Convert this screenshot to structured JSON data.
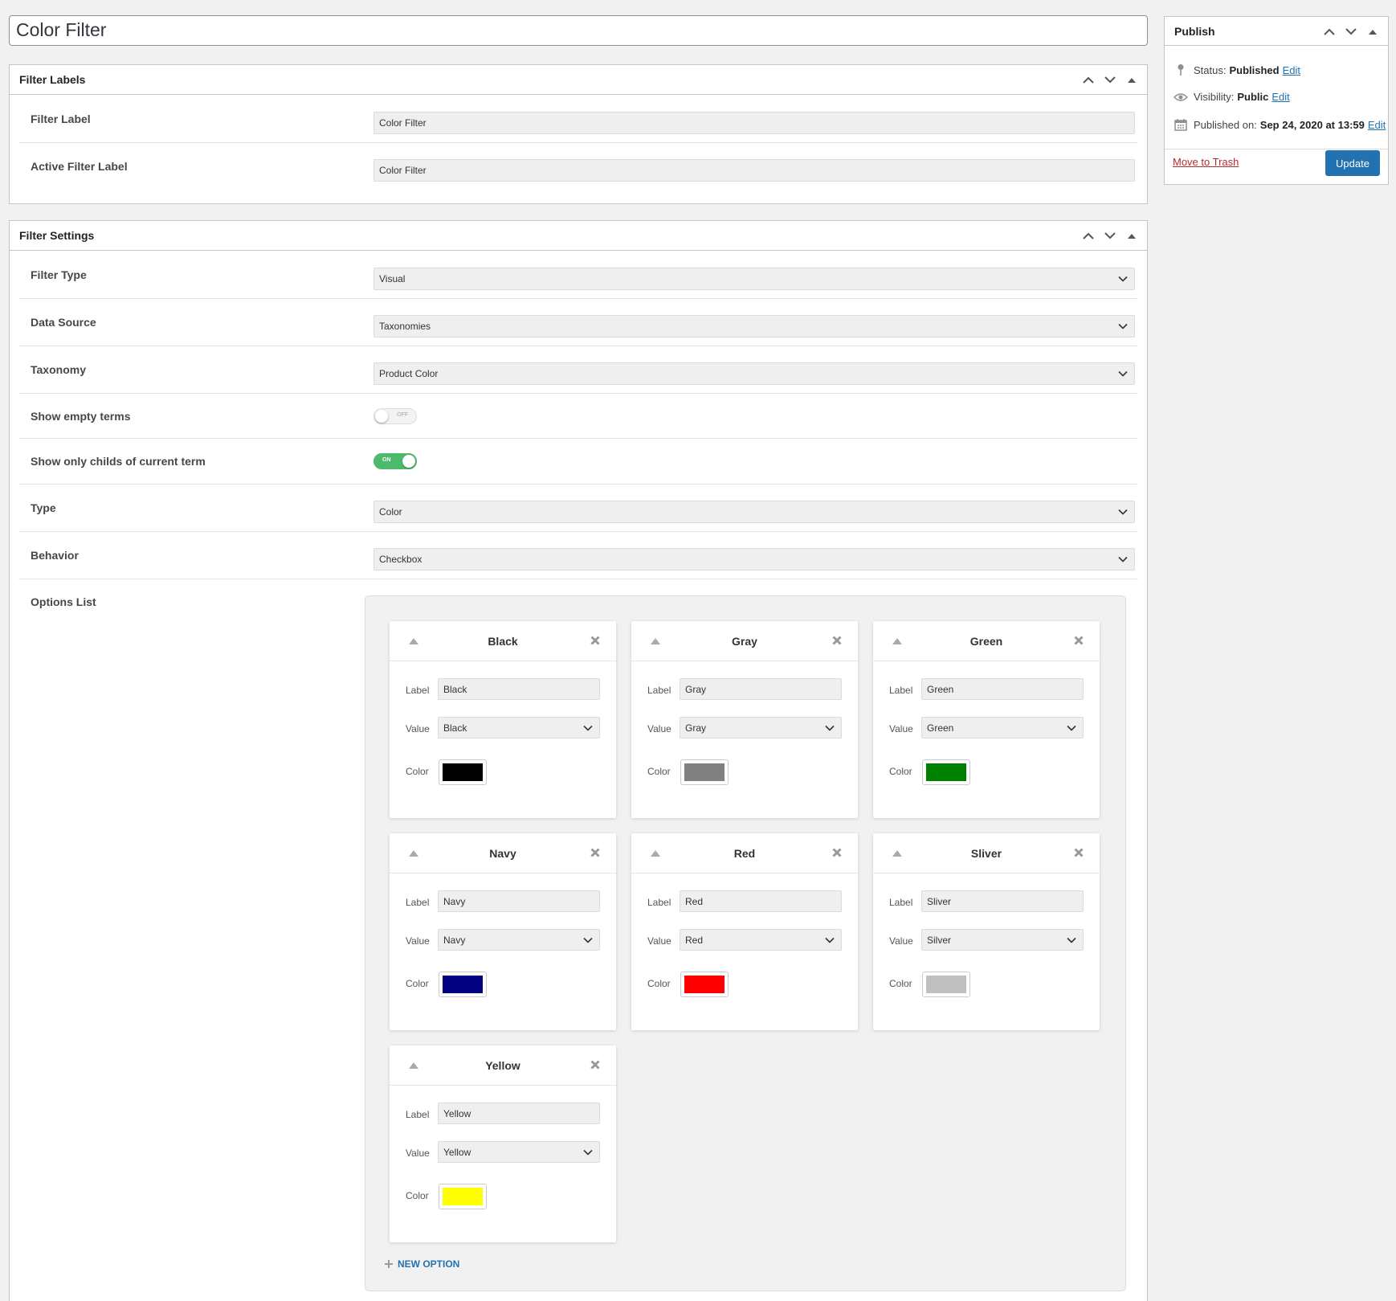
{
  "post": {
    "title": "Color Filter"
  },
  "filter_labels": {
    "title": "Filter Labels",
    "filter_label": {
      "label": "Filter Label",
      "value": "Color Filter"
    },
    "active_filter_label": {
      "label": "Active Filter Label",
      "value": "Color Filter"
    }
  },
  "filter_settings": {
    "title": "Filter Settings",
    "filter_type": {
      "label": "Filter Type",
      "value": "Visual"
    },
    "data_source": {
      "label": "Data Source",
      "value": "Taxonomies"
    },
    "taxonomy": {
      "label": "Taxonomy",
      "value": "Product Color"
    },
    "show_empty_terms": {
      "label": "Show empty terms",
      "state": "OFF"
    },
    "show_only_childs": {
      "label": "Show only childs of current term",
      "state": "ON"
    },
    "type": {
      "label": "Type",
      "value": "Color"
    },
    "behavior": {
      "label": "Behavior",
      "value": "Checkbox"
    },
    "options_list": {
      "label": "Options List",
      "field_labels": {
        "label": "Label",
        "value": "Value",
        "color": "Color"
      },
      "new_option": "NEW OPTION",
      "options": [
        {
          "title": "Black",
          "label": "Black",
          "value": "Black",
          "color": "#000000"
        },
        {
          "title": "Gray",
          "label": "Gray",
          "value": "Gray",
          "color": "#808080"
        },
        {
          "title": "Green",
          "label": "Green",
          "value": "Green",
          "color": "#008000"
        },
        {
          "title": "Navy",
          "label": "Navy",
          "value": "Navy",
          "color": "#000080"
        },
        {
          "title": "Red",
          "label": "Red",
          "value": "Red",
          "color": "#ff0000"
        },
        {
          "title": "Sliver",
          "label": "Sliver",
          "value": "Silver",
          "color": "#c0c0c0"
        },
        {
          "title": "Yellow",
          "label": "Yellow",
          "value": "Yellow",
          "color": "#ffff00"
        }
      ]
    }
  },
  "publish": {
    "title": "Publish",
    "status_label": "Status:",
    "status_value": "Published",
    "status_edit": "Edit",
    "visibility_label": "Visibility:",
    "visibility_value": "Public",
    "visibility_edit": "Edit",
    "published_label": "Published on:",
    "published_value": "Sep 24, 2020 at 13:59",
    "published_edit": "Edit",
    "trash": "Move to Trash",
    "update": "Update"
  },
  "colors": {
    "accent": "#2271b1",
    "toggle_on": "#4cba6b",
    "trash": "#b32d2e"
  }
}
